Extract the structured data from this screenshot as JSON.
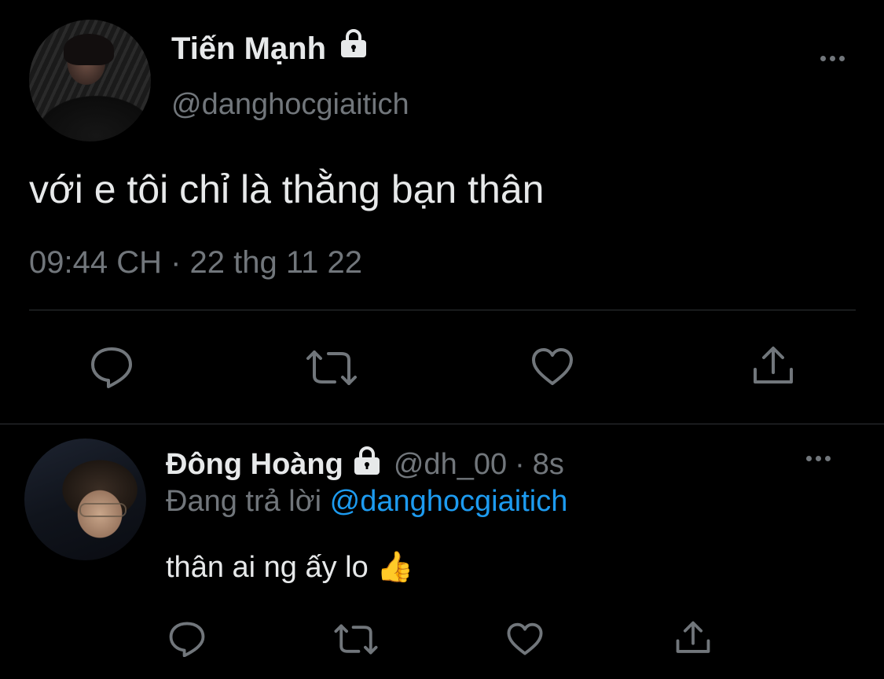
{
  "tweet": {
    "author_name": "Tiến Mạnh",
    "author_handle": "@danghocgiaitich",
    "text": "với e tôi chỉ là thằng bạn thân",
    "timestamp": "09:44 CH · 22 thg 11 22",
    "locked": true
  },
  "reply": {
    "author_name": "Đông Hoàng",
    "author_handle": "@dh_00",
    "time_sep": "·",
    "time": "8s",
    "replying_prefix": "Đang trả lời",
    "replying_to": "@danghocgiaitich",
    "text": "thân ai ng ấy lo",
    "emoji": "👍",
    "locked": true
  },
  "icons": {
    "reply": "reply-icon",
    "retweet": "retweet-icon",
    "like": "like-icon",
    "share": "share-icon",
    "more": "more-icon",
    "lock": "lock-icon"
  },
  "colors": {
    "background": "#000000",
    "text": "#e7e9ea",
    "muted": "#71767b",
    "link": "#1d9bf0",
    "divider": "#2f3336"
  }
}
